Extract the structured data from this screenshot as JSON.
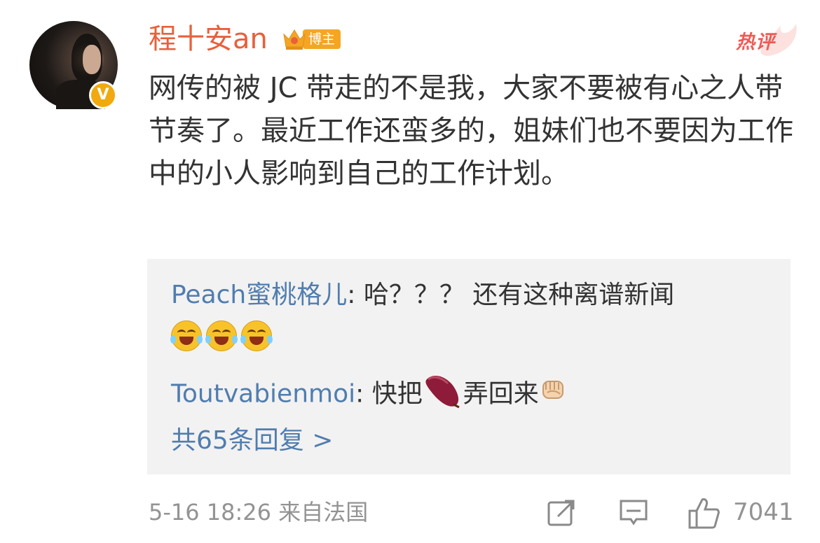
{
  "post": {
    "author_name": "程十安an",
    "blogger_tag": "博主",
    "hot_label": "热评",
    "text": "网传的被 JC 带走的不是我，大家不要被有心之人带节奏了。最近工作还蛮多的，姐妹们也不要因为工作中的小人影响到自己的工作计划。"
  },
  "replies": [
    {
      "user": "Peach蜜桃格儿",
      "sep": ": ",
      "text": "哈？？？ 还有这种离谱新闻"
    },
    {
      "user": "Toutvabienmoi",
      "sep": ": ",
      "text_before": "快把",
      "text_after": "弄回来"
    }
  ],
  "more_replies": "共65条回复 >",
  "footer": {
    "time_source": "5-16 18:26  来自法国",
    "like_count": "7041"
  },
  "icons": {
    "verified": "verified-v-badge",
    "crown": "crown-icon",
    "laugh_cry": "laugh-cry-emoji",
    "sweet_potato": "sweet-potato-emoji",
    "fist": "fist-emoji",
    "share": "share-icon",
    "comment": "comment-icon",
    "like": "like-icon"
  },
  "colors": {
    "author_name": "#e8603c",
    "link_blue": "#507daf",
    "badge_gold": "#f4a623",
    "hot_red": "#ee5b55"
  }
}
